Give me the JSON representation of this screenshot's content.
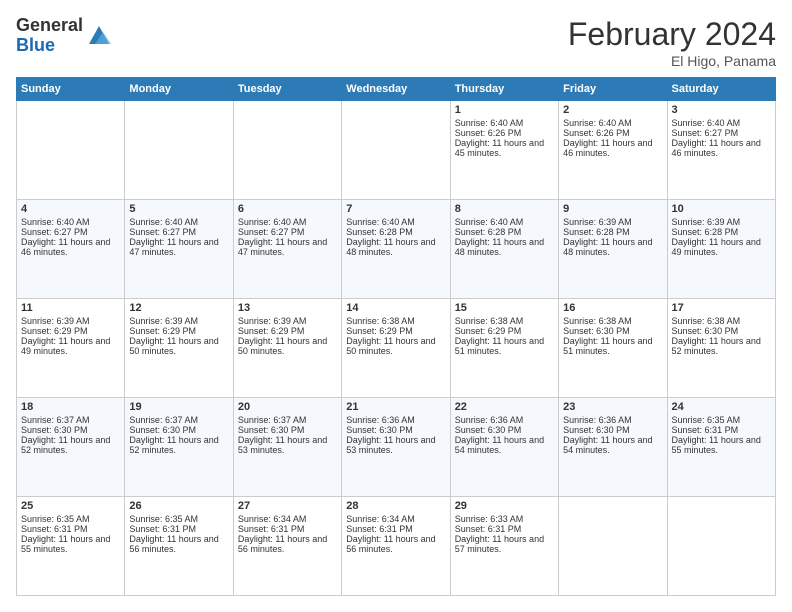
{
  "header": {
    "logo_general": "General",
    "logo_blue": "Blue",
    "month_title": "February 2024",
    "location": "El Higo, Panama"
  },
  "days_of_week": [
    "Sunday",
    "Monday",
    "Tuesday",
    "Wednesday",
    "Thursday",
    "Friday",
    "Saturday"
  ],
  "weeks": [
    [
      {
        "day": "",
        "info": ""
      },
      {
        "day": "",
        "info": ""
      },
      {
        "day": "",
        "info": ""
      },
      {
        "day": "",
        "info": ""
      },
      {
        "day": "1",
        "info": "Sunrise: 6:40 AM\nSunset: 6:26 PM\nDaylight: 11 hours and 45 minutes."
      },
      {
        "day": "2",
        "info": "Sunrise: 6:40 AM\nSunset: 6:26 PM\nDaylight: 11 hours and 46 minutes."
      },
      {
        "day": "3",
        "info": "Sunrise: 6:40 AM\nSunset: 6:27 PM\nDaylight: 11 hours and 46 minutes."
      }
    ],
    [
      {
        "day": "4",
        "info": "Sunrise: 6:40 AM\nSunset: 6:27 PM\nDaylight: 11 hours and 46 minutes."
      },
      {
        "day": "5",
        "info": "Sunrise: 6:40 AM\nSunset: 6:27 PM\nDaylight: 11 hours and 47 minutes."
      },
      {
        "day": "6",
        "info": "Sunrise: 6:40 AM\nSunset: 6:27 PM\nDaylight: 11 hours and 47 minutes."
      },
      {
        "day": "7",
        "info": "Sunrise: 6:40 AM\nSunset: 6:28 PM\nDaylight: 11 hours and 48 minutes."
      },
      {
        "day": "8",
        "info": "Sunrise: 6:40 AM\nSunset: 6:28 PM\nDaylight: 11 hours and 48 minutes."
      },
      {
        "day": "9",
        "info": "Sunrise: 6:39 AM\nSunset: 6:28 PM\nDaylight: 11 hours and 48 minutes."
      },
      {
        "day": "10",
        "info": "Sunrise: 6:39 AM\nSunset: 6:28 PM\nDaylight: 11 hours and 49 minutes."
      }
    ],
    [
      {
        "day": "11",
        "info": "Sunrise: 6:39 AM\nSunset: 6:29 PM\nDaylight: 11 hours and 49 minutes."
      },
      {
        "day": "12",
        "info": "Sunrise: 6:39 AM\nSunset: 6:29 PM\nDaylight: 11 hours and 50 minutes."
      },
      {
        "day": "13",
        "info": "Sunrise: 6:39 AM\nSunset: 6:29 PM\nDaylight: 11 hours and 50 minutes."
      },
      {
        "day": "14",
        "info": "Sunrise: 6:38 AM\nSunset: 6:29 PM\nDaylight: 11 hours and 50 minutes."
      },
      {
        "day": "15",
        "info": "Sunrise: 6:38 AM\nSunset: 6:29 PM\nDaylight: 11 hours and 51 minutes."
      },
      {
        "day": "16",
        "info": "Sunrise: 6:38 AM\nSunset: 6:30 PM\nDaylight: 11 hours and 51 minutes."
      },
      {
        "day": "17",
        "info": "Sunrise: 6:38 AM\nSunset: 6:30 PM\nDaylight: 11 hours and 52 minutes."
      }
    ],
    [
      {
        "day": "18",
        "info": "Sunrise: 6:37 AM\nSunset: 6:30 PM\nDaylight: 11 hours and 52 minutes."
      },
      {
        "day": "19",
        "info": "Sunrise: 6:37 AM\nSunset: 6:30 PM\nDaylight: 11 hours and 52 minutes."
      },
      {
        "day": "20",
        "info": "Sunrise: 6:37 AM\nSunset: 6:30 PM\nDaylight: 11 hours and 53 minutes."
      },
      {
        "day": "21",
        "info": "Sunrise: 6:36 AM\nSunset: 6:30 PM\nDaylight: 11 hours and 53 minutes."
      },
      {
        "day": "22",
        "info": "Sunrise: 6:36 AM\nSunset: 6:30 PM\nDaylight: 11 hours and 54 minutes."
      },
      {
        "day": "23",
        "info": "Sunrise: 6:36 AM\nSunset: 6:30 PM\nDaylight: 11 hours and 54 minutes."
      },
      {
        "day": "24",
        "info": "Sunrise: 6:35 AM\nSunset: 6:31 PM\nDaylight: 11 hours and 55 minutes."
      }
    ],
    [
      {
        "day": "25",
        "info": "Sunrise: 6:35 AM\nSunset: 6:31 PM\nDaylight: 11 hours and 55 minutes."
      },
      {
        "day": "26",
        "info": "Sunrise: 6:35 AM\nSunset: 6:31 PM\nDaylight: 11 hours and 56 minutes."
      },
      {
        "day": "27",
        "info": "Sunrise: 6:34 AM\nSunset: 6:31 PM\nDaylight: 11 hours and 56 minutes."
      },
      {
        "day": "28",
        "info": "Sunrise: 6:34 AM\nSunset: 6:31 PM\nDaylight: 11 hours and 56 minutes."
      },
      {
        "day": "29",
        "info": "Sunrise: 6:33 AM\nSunset: 6:31 PM\nDaylight: 11 hours and 57 minutes."
      },
      {
        "day": "",
        "info": ""
      },
      {
        "day": "",
        "info": ""
      }
    ]
  ]
}
